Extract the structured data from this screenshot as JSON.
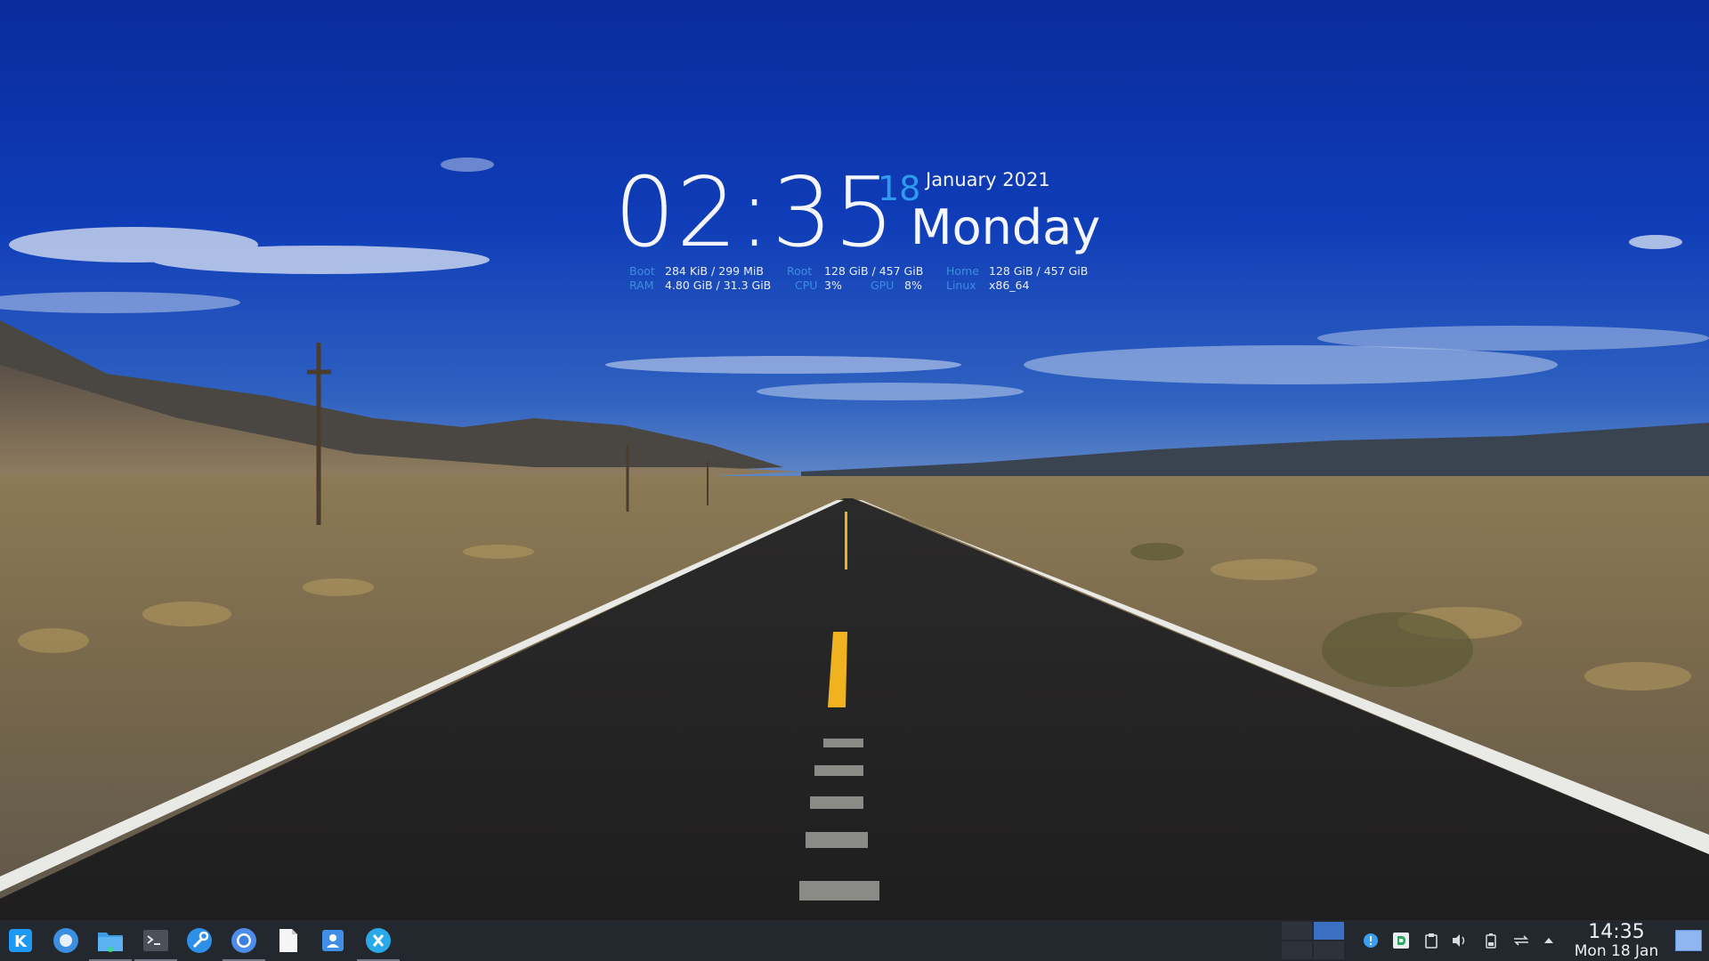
{
  "conky": {
    "time": "02:35",
    "day_number": "18",
    "month_year": "January 2021",
    "weekday": "Monday",
    "stats": [
      {
        "label": "Boot",
        "value": "284 KiB / 299 MiB"
      },
      {
        "label": "RAM",
        "value": "4.80 GiB / 31.3 GiB"
      },
      {
        "label": "Root",
        "value": "128 GiB / 457 GiB"
      },
      {
        "label": "CPU",
        "value": "3%"
      },
      {
        "label": "GPU",
        "value": "8%"
      },
      {
        "label": "Home",
        "value": "128 GiB / 457 GiB"
      },
      {
        "label": "Linux",
        "value": "x86_64"
      }
    ]
  },
  "taskbar": {
    "launchers": [
      {
        "icon": "kde-app-launcher-icon"
      },
      {
        "icon": "system-settings-icon"
      },
      {
        "icon": "file-manager-icon"
      },
      {
        "icon": "terminal-icon"
      },
      {
        "icon": "tools-icon"
      },
      {
        "icon": "chromium-browser-icon"
      },
      {
        "icon": "text-editor-icon"
      },
      {
        "icon": "contacts-icon"
      },
      {
        "icon": "discover-icon"
      }
    ],
    "tray": [
      {
        "icon": "notification-info-icon"
      },
      {
        "icon": "dropbox-icon"
      },
      {
        "icon": "clipboard-icon"
      },
      {
        "icon": "volume-icon"
      },
      {
        "icon": "battery-icon"
      },
      {
        "icon": "kde-connect-icon"
      },
      {
        "icon": "expand-tray-arrow-icon"
      }
    ],
    "clock_time": "14:35",
    "clock_date": "Mon 18 Jan"
  },
  "colors": {
    "accent": "#2e9bf0",
    "panel": "#23272e",
    "sky_top": "#0a2ea8",
    "sky_bottom": "#3d74c6"
  }
}
